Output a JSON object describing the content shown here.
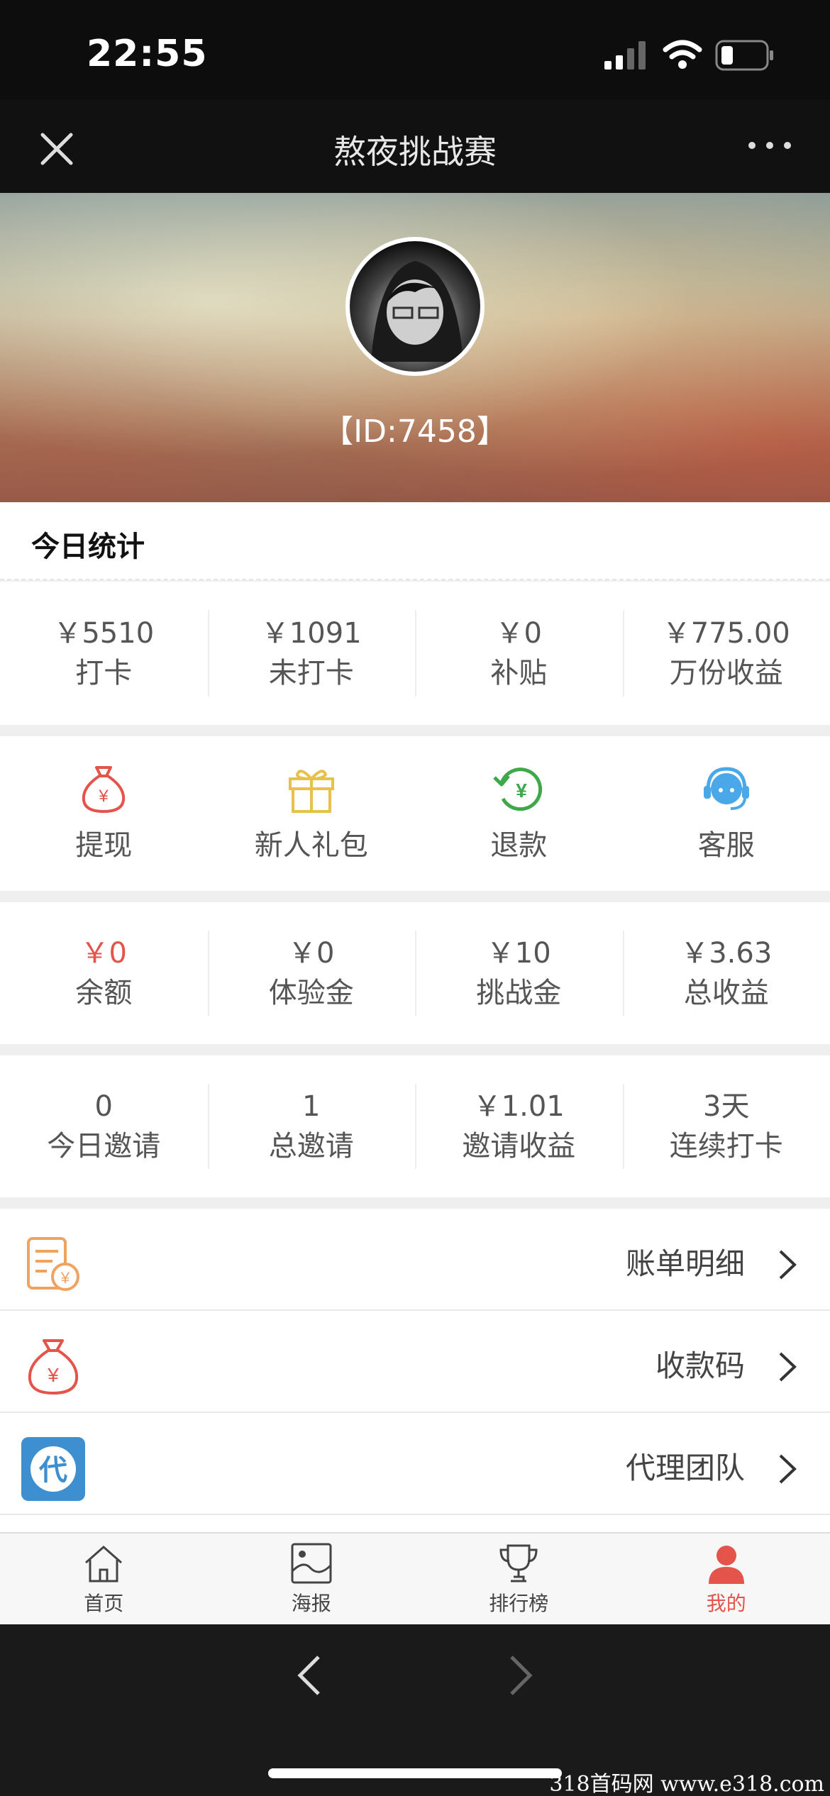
{
  "status_bar": {
    "time": "22:55"
  },
  "nav": {
    "title": "熬夜挑战赛"
  },
  "profile": {
    "id_text": "【ID:7458】"
  },
  "today": {
    "heading": "今日统计",
    "stats": [
      {
        "value": "￥5510",
        "label": "打卡"
      },
      {
        "value": "￥1091",
        "label": "未打卡"
      },
      {
        "value": "￥0",
        "label": "补贴"
      },
      {
        "value": "￥775.00",
        "label": "万份收益"
      }
    ]
  },
  "actions": [
    {
      "label": "提现",
      "icon": "money-bag-icon",
      "color": "#e5544b"
    },
    {
      "label": "新人礼包",
      "icon": "gift-icon",
      "color": "#e8c14a"
    },
    {
      "label": "退款",
      "icon": "refund-icon",
      "color": "#3fa84a"
    },
    {
      "label": "客服",
      "icon": "headset-icon",
      "color": "#4aa8e8"
    }
  ],
  "wallet": [
    {
      "value": "￥0",
      "label": "余额",
      "highlight": true
    },
    {
      "value": "￥0",
      "label": "体验金"
    },
    {
      "value": "￥10",
      "label": "挑战金"
    },
    {
      "value": "￥3.63",
      "label": "总收益"
    }
  ],
  "invite": [
    {
      "value": "0",
      "label": "今日邀请"
    },
    {
      "value": "1",
      "label": "总邀请"
    },
    {
      "value": "￥1.01",
      "label": "邀请收益"
    },
    {
      "value": "3天",
      "label": "连续打卡"
    }
  ],
  "menu": [
    {
      "label": "账单明细",
      "icon": "bill-icon"
    },
    {
      "label": "收款码",
      "icon": "money-bag-icon"
    },
    {
      "label": "代理团队",
      "icon": "agent-icon",
      "icon_text": "代"
    }
  ],
  "tabbar": [
    {
      "label": "首页",
      "icon": "home-icon"
    },
    {
      "label": "海报",
      "icon": "poster-icon"
    },
    {
      "label": "排行榜",
      "icon": "trophy-icon"
    },
    {
      "label": "我的",
      "icon": "person-icon",
      "active": true
    }
  ],
  "watermark": "318首码网 www.e318.com",
  "colors": {
    "accent": "#e5544b",
    "bg": "#efefef"
  }
}
